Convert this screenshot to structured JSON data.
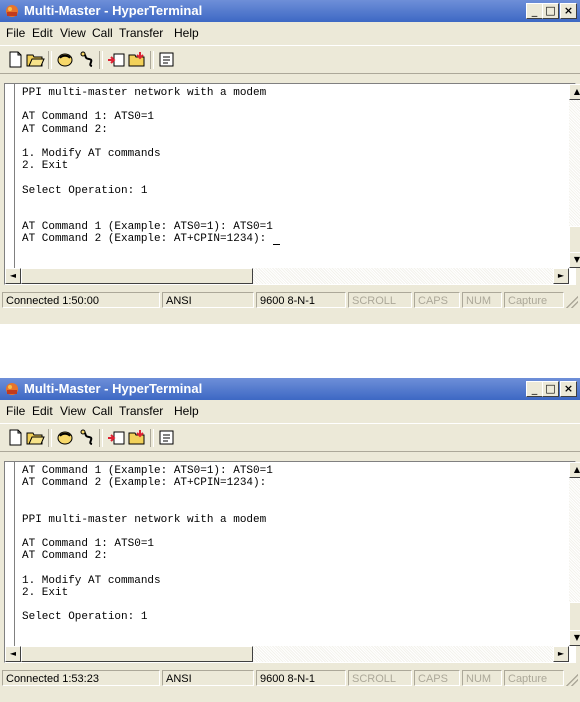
{
  "windows": [
    {
      "title": "Multi-Master - HyperTerminal",
      "menu": [
        "File",
        "Edit",
        "View",
        "Call",
        "Transfer",
        "Help"
      ],
      "terminal_lines": [
        "PPI multi-master network with a modem",
        "",
        "AT Command 1: ATS0=1",
        "AT Command 2:",
        "",
        "1. Modify AT commands",
        "2. Exit",
        "",
        "Select Operation: 1",
        "",
        "",
        "AT Command 1 (Example: ATS0=1): ATS0=1",
        "AT Command 2 (Example: AT+CPIN=1234): "
      ],
      "status": {
        "connected": "Connected 1:50:00",
        "emulation": "ANSI",
        "port_settings": "9600 8-N-1",
        "scroll": "SCROLL",
        "caps": "CAPS",
        "num": "NUM",
        "capture": "Capture"
      }
    },
    {
      "title": "Multi-Master - HyperTerminal",
      "menu": [
        "File",
        "Edit",
        "View",
        "Call",
        "Transfer",
        "Help"
      ],
      "terminal_lines": [
        "AT Command 1 (Example: ATS0=1): ATS0=1",
        "AT Command 2 (Example: AT+CPIN=1234):",
        "",
        "",
        "PPI multi-master network with a modem",
        "",
        "AT Command 1: ATS0=1",
        "AT Command 2:",
        "",
        "1. Modify AT commands",
        "2. Exit",
        "",
        "Select Operation: 1"
      ],
      "status": {
        "connected": "Connected 1:53:23",
        "emulation": "ANSI",
        "port_settings": "9600 8-N-1",
        "scroll": "SCROLL",
        "caps": "CAPS",
        "num": "NUM",
        "capture": "Capture"
      }
    }
  ],
  "window_controls": {
    "minimize": "_",
    "maximize": "□",
    "close": "×"
  },
  "icons": [
    "hyperterminal-app-icon",
    "new-connection-icon",
    "open-icon",
    "connect-icon",
    "disconnect-icon",
    "send-icon",
    "receive-icon",
    "properties-icon"
  ],
  "colors": {
    "titlebar": "#3d68c4",
    "chrome": "#ece9d8",
    "terminal_bg": "#ffffff"
  }
}
